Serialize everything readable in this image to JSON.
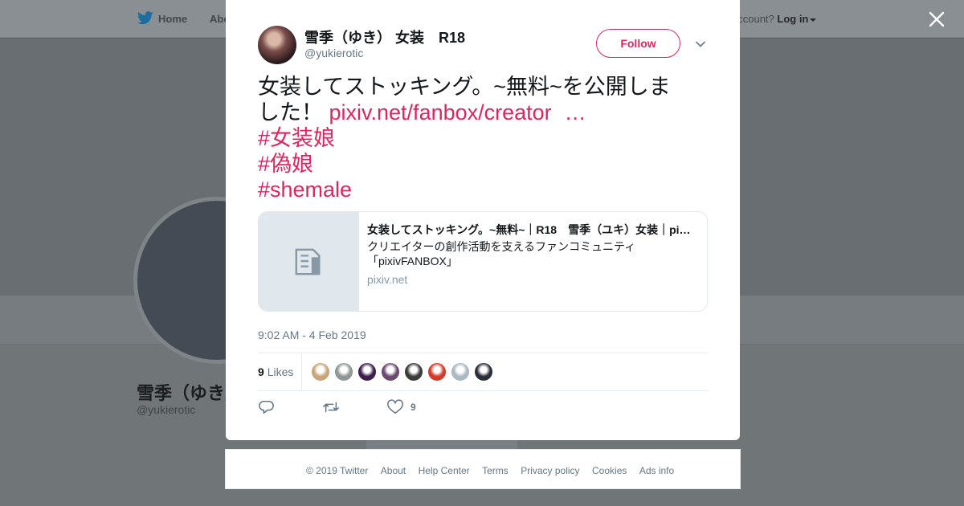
{
  "topnav": {
    "home_label": "Home",
    "about_label": "Abo",
    "account_prompt": "account?",
    "login_label": "Log in"
  },
  "profile_bg": {
    "name": "雪季（ゆき）",
    "handle": "@yukierotic"
  },
  "tweet": {
    "author_name": "雪季（ゆき） 女装　R18",
    "author_handle": "@yukierotic",
    "follow_label": "Follow",
    "text_line1": "女装してストッキング。~無料~を公開しま",
    "text_line2": "した！ ",
    "link_text": "pixiv.net/fanbox/creator",
    "link_ellipsis": "…",
    "hashtags": [
      "#女装娘",
      "#偽娘",
      "#shemale"
    ],
    "card": {
      "title": "女装してストッキング。~無料~｜R18　雪季（ユキ）女装｜pixivFANBOX",
      "description": "クリエイターの創作活動を支えるファンコミュニティ「pixivFANBOX」",
      "domain": "pixiv.net"
    },
    "timestamp": "9:02 AM - 4 Feb 2019",
    "likes_count": "9",
    "likes_label": "Likes",
    "like_action_count": "9",
    "liker_avatar_colors": [
      "#c8a57a",
      "#8d9896",
      "#3b1f4f",
      "#6a4a6f",
      "#3c3c3c",
      "#d43a2a",
      "#aab8c2",
      "#2b2f3a"
    ]
  },
  "footer": {
    "links": [
      "© 2019 Twitter",
      "About",
      "Help Center",
      "Terms",
      "Privacy policy",
      "Cookies",
      "Ads info"
    ]
  },
  "colors": {
    "accent": "#e0245e",
    "text_primary": "#14171a",
    "text_secondary": "#657786",
    "twitter_blue": "#1da1f2"
  },
  "icons": {
    "logo": "twitter-bird-icon",
    "close": "close-icon",
    "caret": "chevron-down-icon",
    "reply": "reply-icon",
    "retweet": "retweet-icon",
    "like": "heart-icon",
    "card_placeholder": "document-icon"
  }
}
